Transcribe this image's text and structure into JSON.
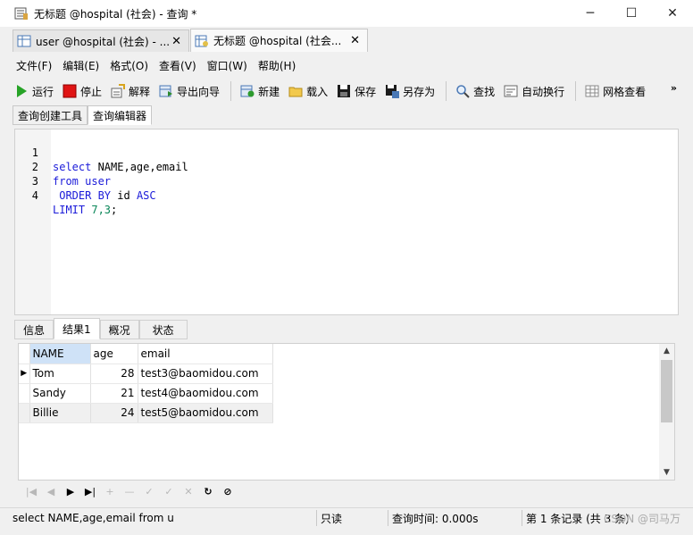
{
  "window": {
    "title": "无标题 @hospital (社会) - 查询 *",
    "minimize": "─",
    "maximize": "☐",
    "close": "✕"
  },
  "doc_tabs": [
    {
      "label": "user @hospital (社会) - ...",
      "close": "✕"
    },
    {
      "label": "无标题 @hospital (社会...",
      "close": "✕"
    }
  ],
  "menu": [
    "文件(F)",
    "编辑(E)",
    "格式(O)",
    "查看(V)",
    "窗口(W)",
    "帮助(H)"
  ],
  "toolbar": {
    "run": "运行",
    "stop": "停止",
    "explain": "解释",
    "export_wizard": "导出向导",
    "new": "新建",
    "load": "载入",
    "save": "保存",
    "save_as": "另存为",
    "find": "查找",
    "word_wrap": "自动换行",
    "grid_view": "网格查看",
    "more": "»"
  },
  "sub_tabs": [
    "查询创建工具",
    "查询编辑器"
  ],
  "editor": {
    "lines": [
      {
        "n": "1",
        "kw1": "select",
        "rest": " NAME,age,email"
      },
      {
        "n": "2",
        "kw1": "from",
        "rest": " user"
      },
      {
        "n": "3",
        "kw1": " ORDER BY",
        "rest": " id ",
        "kw2": "ASC"
      },
      {
        "n": "4",
        "kw1": "LIMIT",
        "num": " 7,3",
        "rest": ";"
      }
    ]
  },
  "result_tabs": [
    "信息",
    "结果1",
    "概况",
    "状态"
  ],
  "result": {
    "columns": [
      "NAME",
      "age",
      "email"
    ],
    "rows": [
      {
        "name": "Tom",
        "age": "28",
        "email": "test3@baomidou.com"
      },
      {
        "name": "Sandy",
        "age": "21",
        "email": "test4@baomidou.com"
      },
      {
        "name": "Billie",
        "age": "24",
        "email": "test5@baomidou.com"
      }
    ],
    "current_row_marker": "▶"
  },
  "nav": {
    "first": "|◀",
    "prev": "◀",
    "next": "▶",
    "last": "▶|",
    "add": "+",
    "delete": "—",
    "edit": "✓",
    "apply": "✓",
    "cancel": "✕",
    "refresh": "↻",
    "stop": "⊘"
  },
  "status": {
    "sql": "select NAME,age,email  from u",
    "readonly": "只读",
    "query_time": "查询时间: 0.000s",
    "record": "第 1 条记录 (共 3 条)",
    "watermark": "CSDN @司马万"
  }
}
